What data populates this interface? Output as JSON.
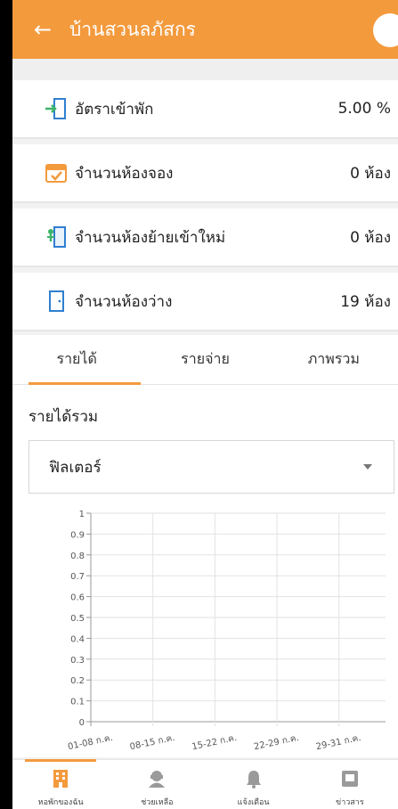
{
  "header": {
    "title": "บ้านสวนลภัสกร",
    "back_icon": "arrow-left-icon"
  },
  "stats": [
    {
      "icon": "check-in-door-icon",
      "label": "อัตราเข้าพัก",
      "value": "5.00 %"
    },
    {
      "icon": "calendar-check-icon",
      "label": "จำนวนห้องจอง",
      "value": "0 ห้อง"
    },
    {
      "icon": "move-in-door-icon",
      "label": "จำนวนห้องย้ายเข้าใหม่",
      "value": "0 ห้อง"
    },
    {
      "icon": "empty-door-icon",
      "label": "จำนวนห้องว่าง",
      "value": "19 ห้อง"
    }
  ],
  "tabs": [
    {
      "label": "รายได้",
      "active": true
    },
    {
      "label": "รายจ่าย",
      "active": false
    },
    {
      "label": "ภาพรวม",
      "active": false
    }
  ],
  "income": {
    "title": "รายได้รวม",
    "filter_label": "ฟิลเตอร์"
  },
  "chart_data": {
    "type": "line",
    "categories": [
      "01-08 ก.ค.",
      "08-15 ก.ค.",
      "15-22 ก.ค.",
      "22-29 ก.ค.",
      "29-31 ก.ค."
    ],
    "series": [
      {
        "values": [
          0,
          0,
          0,
          0,
          0
        ]
      }
    ],
    "y_ticks": [
      "0",
      "0.1",
      "0.2",
      "0.3",
      "0.4",
      "0.5",
      "0.6",
      "0.7",
      "0.8",
      "0.9",
      "1"
    ],
    "ylim": [
      0,
      1
    ],
    "grid": true,
    "title": "",
    "xlabel": "",
    "ylabel": ""
  },
  "bottom_nav": [
    {
      "icon": "building-icon",
      "label": "หอพักของฉัน",
      "active": true
    },
    {
      "icon": "support-agent-icon",
      "label": "ช่วยเหลือ",
      "active": false
    },
    {
      "icon": "bell-icon",
      "label": "แจ้งเตือน",
      "active": false
    },
    {
      "icon": "news-icon",
      "label": "ข่าวสาร",
      "active": false
    }
  ],
  "colors": {
    "accent": "#f39a3d",
    "tab_inactive": "#333333",
    "icon_blue": "#2f7fcf"
  }
}
